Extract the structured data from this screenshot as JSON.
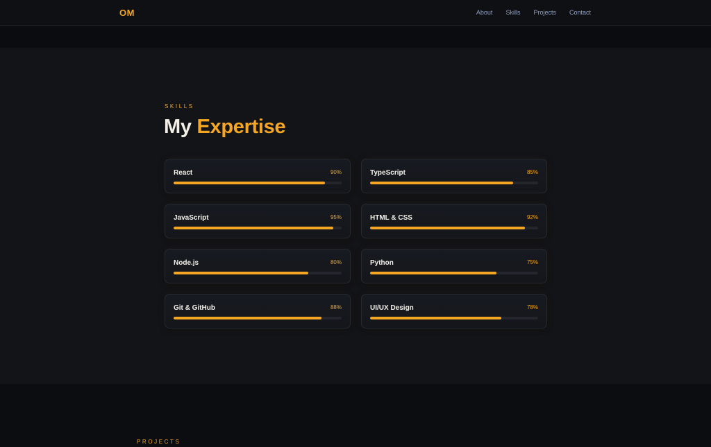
{
  "nav": {
    "logo": "OM",
    "links": [
      {
        "label": "About"
      },
      {
        "label": "Skills"
      },
      {
        "label": "Projects"
      },
      {
        "label": "Contact"
      }
    ]
  },
  "skills": {
    "eyebrow": "SKILLS",
    "heading_main": "My",
    "heading_accent": "Expertise",
    "items": [
      {
        "name": "React",
        "percent_label": "90%",
        "percent": 90
      },
      {
        "name": "TypeScript",
        "percent_label": "85%",
        "percent": 85
      },
      {
        "name": "JavaScript",
        "percent_label": "95%",
        "percent": 95
      },
      {
        "name": "HTML & CSS",
        "percent_label": "92%",
        "percent": 92
      },
      {
        "name": "Node.js",
        "percent_label": "80%",
        "percent": 80
      },
      {
        "name": "Python",
        "percent_label": "75%",
        "percent": 75
      },
      {
        "name": "Git & GitHub",
        "percent_label": "88%",
        "percent": 88
      },
      {
        "name": "UI/UX Design",
        "percent_label": "78%",
        "percent": 78
      }
    ]
  },
  "projects": {
    "eyebrow": "PROJECTS"
  },
  "colors": {
    "accent": "#f5a623",
    "background": "#131418",
    "text": "#f3efe6",
    "nav_link": "#8da0c4"
  }
}
